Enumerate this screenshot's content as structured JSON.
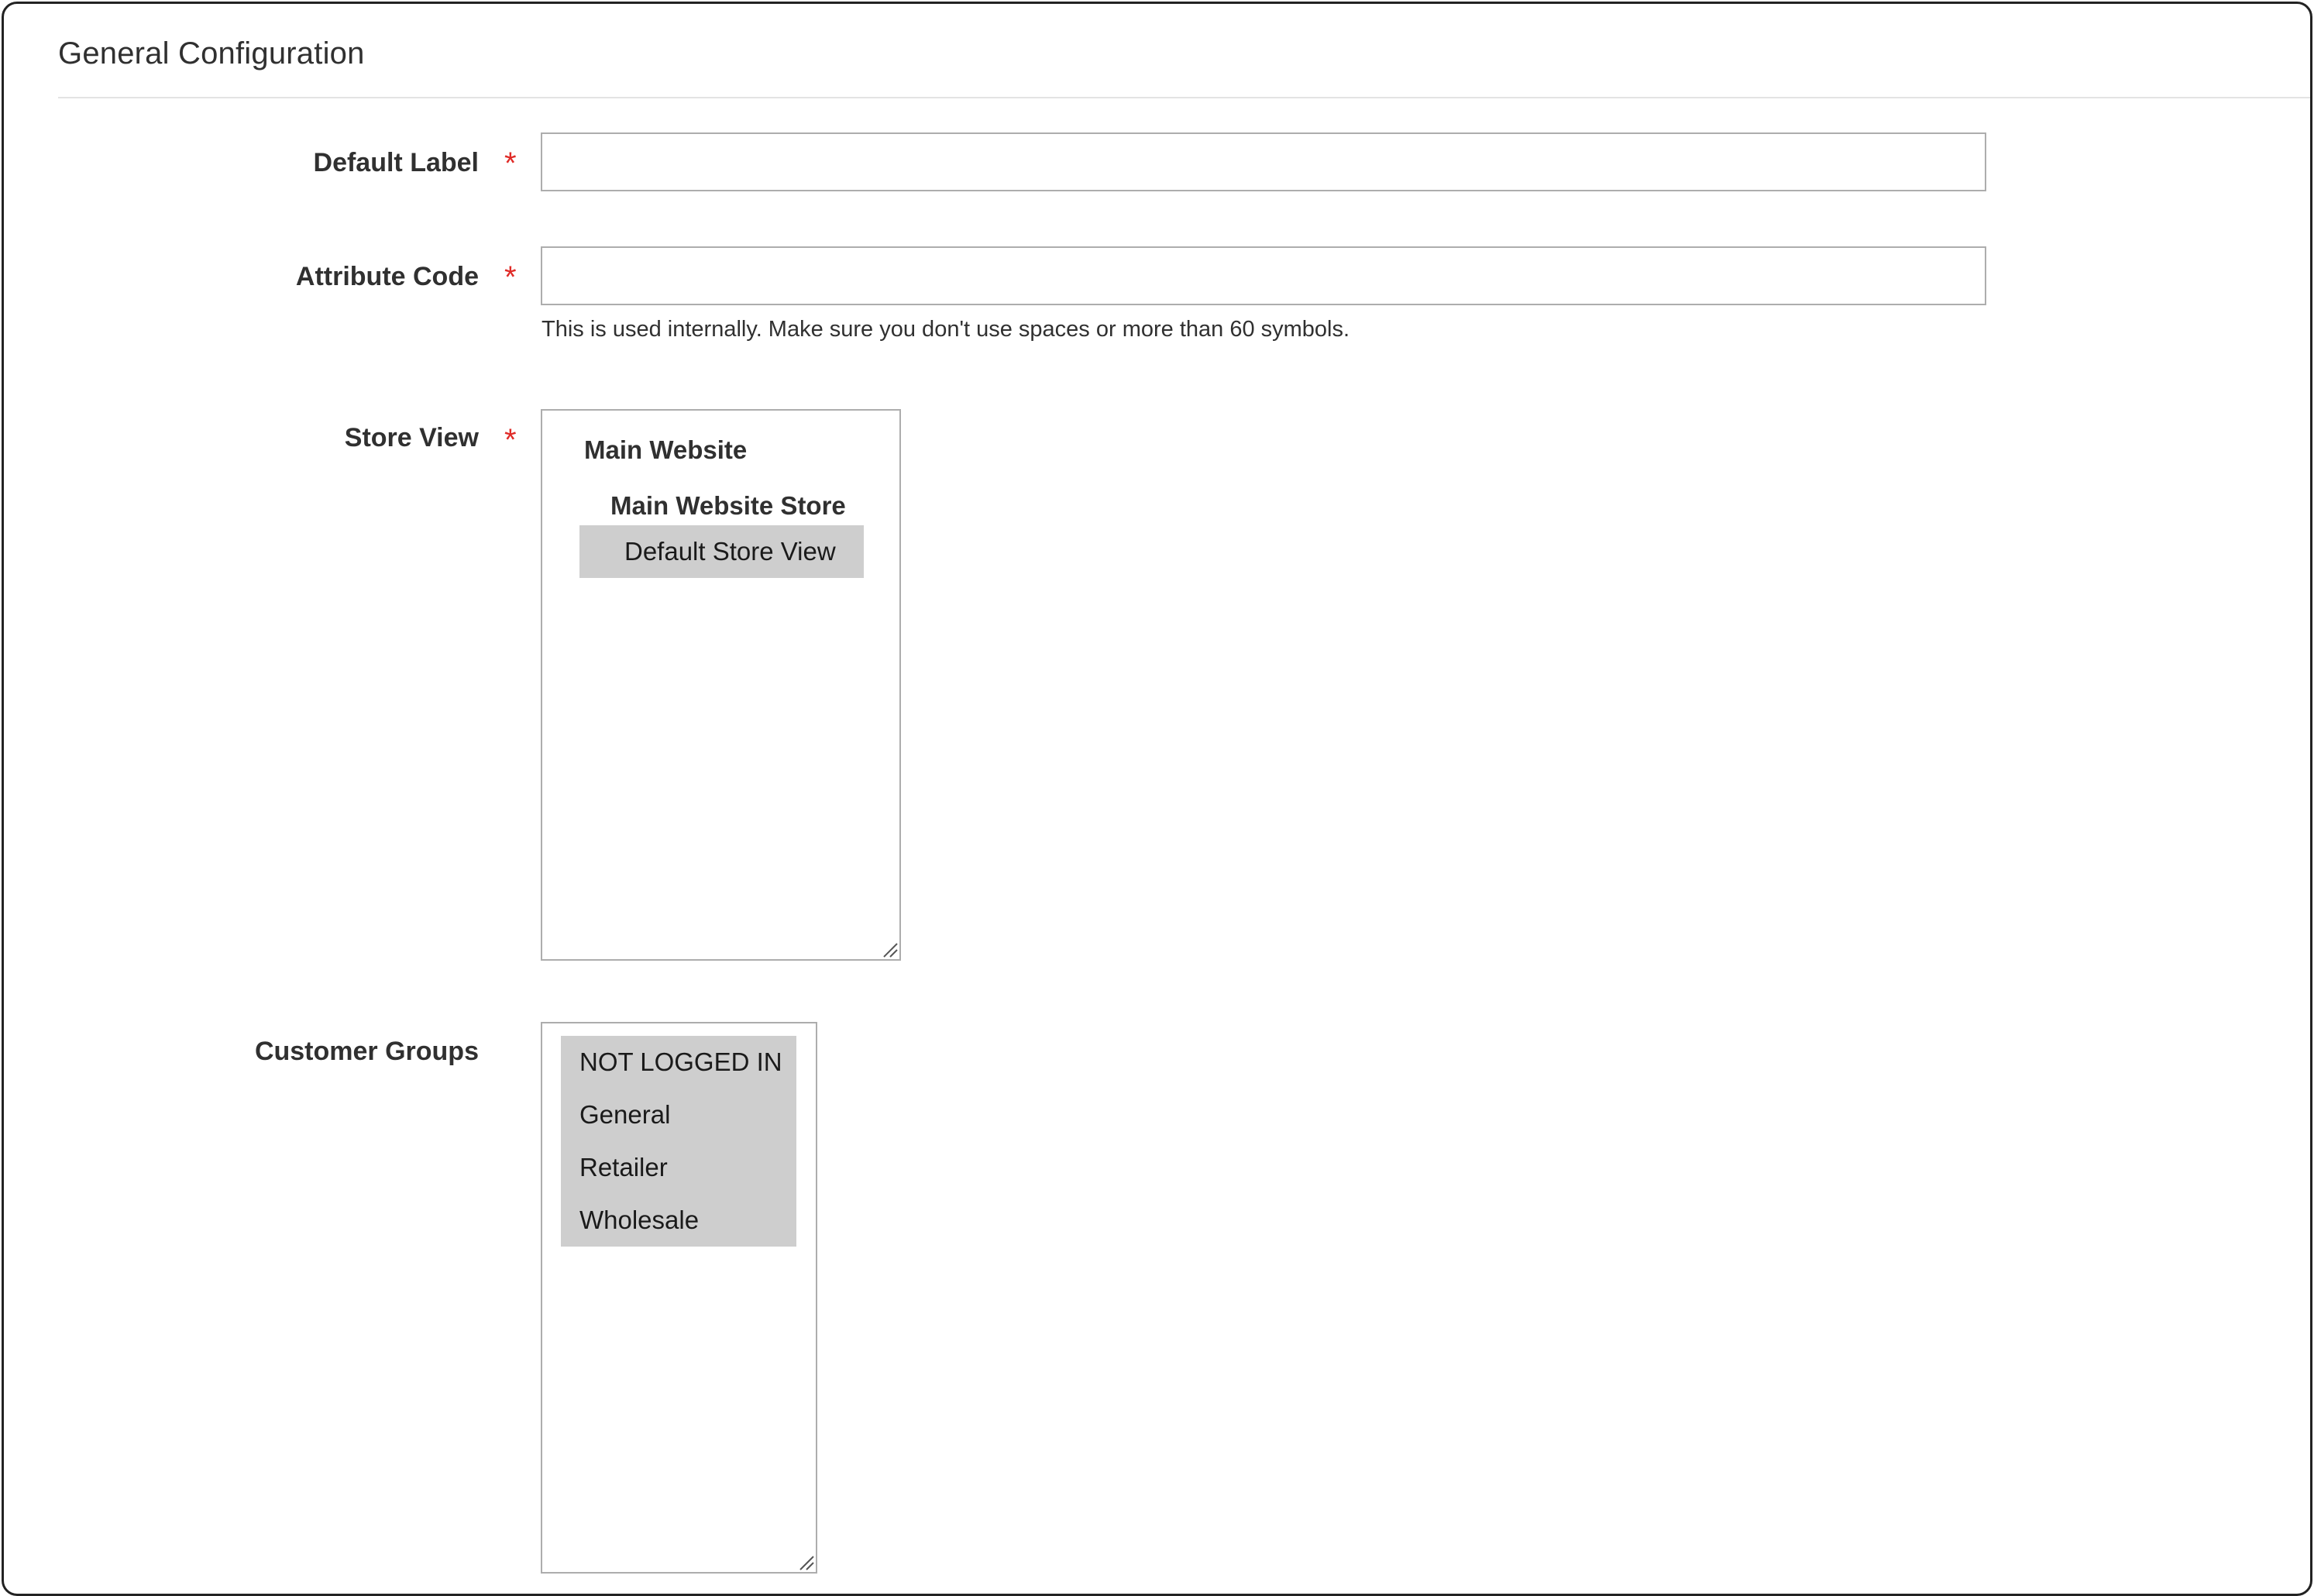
{
  "section": {
    "title": "General Configuration"
  },
  "fields": {
    "default_label": {
      "label": "Default Label",
      "required_marker": "*",
      "value": "",
      "placeholder": ""
    },
    "attribute_code": {
      "label": "Attribute Code",
      "required_marker": "*",
      "value": "",
      "placeholder": "",
      "note": "This is used internally. Make sure you don't use spaces or more than 60 symbols."
    },
    "store_view": {
      "label": "Store View",
      "required_marker": "*",
      "website": "Main Website",
      "store": "Main Website Store",
      "options": [
        {
          "label": "Default Store View",
          "selected": true
        }
      ]
    },
    "customer_groups": {
      "label": "Customer Groups",
      "options": [
        {
          "label": "NOT LOGGED IN",
          "selected": true
        },
        {
          "label": "General",
          "selected": true
        },
        {
          "label": "Retailer",
          "selected": true
        },
        {
          "label": "Wholesale",
          "selected": true
        }
      ]
    }
  },
  "colors": {
    "required": "#e02b27",
    "selected_option_bg": "#cecece",
    "input_border": "#adadad"
  },
  "icons": {
    "resize_grip": "resize-grip-icon"
  }
}
